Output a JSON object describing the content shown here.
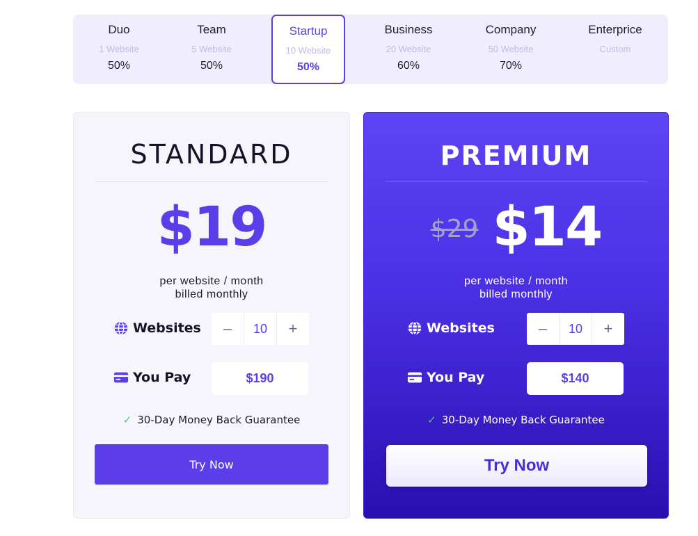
{
  "tiers": [
    {
      "name": "Duo",
      "sites": "1 Website",
      "discount": "50%"
    },
    {
      "name": "Team",
      "sites": "5 Website",
      "discount": "50%"
    },
    {
      "name": "Startup",
      "sites": "10 Website",
      "discount": "50%"
    },
    {
      "name": "Business",
      "sites": "20 Website",
      "discount": "60%"
    },
    {
      "name": "Company",
      "sites": "50 Website",
      "discount": "70%"
    },
    {
      "name": "Enterprice",
      "sites": "Custom",
      "discount": ""
    }
  ],
  "active_tier": "Startup",
  "standard": {
    "title": "STANDARD",
    "price": "$19",
    "per_line1": "per website / month",
    "per_line2": "billed monthly",
    "websites_label": "Websites",
    "websites_value": "10",
    "minus": "–",
    "plus": "+",
    "you_pay_label": "You Pay",
    "you_pay_value": "$190",
    "guarantee": "30-Day Money Back Guarantee",
    "cta": "Try Now"
  },
  "premium": {
    "title": "PREMIUM",
    "old_price": "$29",
    "price": "$14",
    "per_line1": "per website / month",
    "per_line2": "billed monthly",
    "websites_label": "Websites",
    "websites_value": "10",
    "minus": "–",
    "plus": "+",
    "you_pay_label": "You Pay",
    "you_pay_value": "$140",
    "guarantee": "30-Day Money Back Guarantee",
    "cta": "Try Now"
  },
  "colors": {
    "accent": "#5b3ee8",
    "tier_bar_bg": "#f0eefc",
    "premium_top": "#5d44f5",
    "premium_bottom": "#2a0fb0",
    "check": "#4fc36e"
  },
  "icons": {
    "globe": "globe-icon",
    "card": "credit-card-icon",
    "check": "check-icon"
  }
}
